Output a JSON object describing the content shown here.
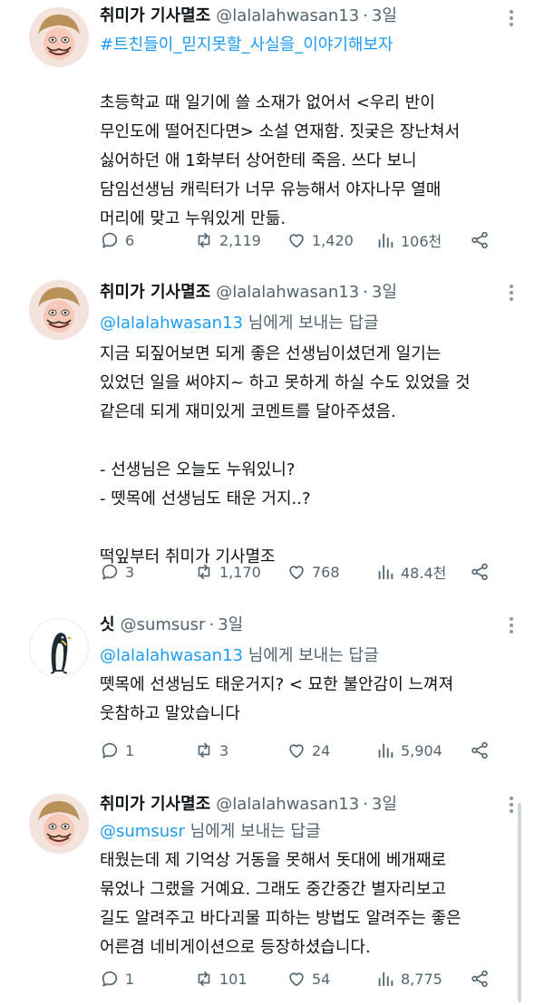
{
  "tweets": [
    {
      "name": "취미가 기사멸조",
      "handle": "@lalalahwasan13",
      "time": "3일",
      "hashtag": "#트친들이_믿지못할_사실을_이야기해보자",
      "body": "초등학교 때 일기에 쓸 소재가 없어서 <우리 반이\n무인도에 떨어진다면> 소설 연재함. 짓궂은 장난쳐서\n싫어하던 애 1화부터 상어한테 죽음. 쓰다 보니\n담임선생님 캐릭터가 너무 유능해서 야자나무 열매\n머리에 맞고 누워있게 만듦.",
      "replies": "6",
      "retweets": "2,119",
      "likes": "1,420",
      "views": "106천"
    },
    {
      "name": "취미가 기사멸조",
      "handle": "@lalalahwasan13",
      "time": "3일",
      "reply_mention": "@lalalahwasan13",
      "reply_suffix": " 님에게 보내는 답글",
      "body": "지금 되짚어보면 되게 좋은 선생님이셨던게 일기는\n있었던 일을 써야지~ 하고 못하게 하실 수도 있었을 것\n같은데 되게 재미있게 코멘트를 달아주셨음.\n\n- 선생님은 오늘도 누워있니?\n- 뗏목에 선생님도 태운 거지..?\n\n떡잎부터 취미가 기사멸조",
      "replies": "3",
      "retweets": "1,170",
      "likes": "768",
      "views": "48.4천"
    },
    {
      "name": "싯",
      "handle": "@sumsusr",
      "time": "3일",
      "reply_mention": "@lalalahwasan13",
      "reply_suffix": " 님에게 보내는 답글",
      "body": "뗏목에 선생님도 태운거지? < 묘한 불안감이 느껴져\n웃참하고 말았습니다",
      "replies": "1",
      "retweets": "3",
      "likes": "24",
      "views": "5,904"
    },
    {
      "name": "취미가 기사멸조",
      "handle": "@lalalahwasan13",
      "time": "3일",
      "reply_mention": "@sumsusr",
      "reply_suffix": " 님에게 보내는 답글",
      "body": "태웠는데 제 기억상 거동을 못해서 돗대에 베개째로\n묶었나 그랬을 거예요. 그래도 중간중간 별자리보고\n길도 알려주고 바다괴물 피하는 방법도 알려주는 좋은\n어른겸 네비게이션으로 등장하셨습니다.",
      "replies": "1",
      "retweets": "101",
      "likes": "54",
      "views": "8,775"
    }
  ]
}
